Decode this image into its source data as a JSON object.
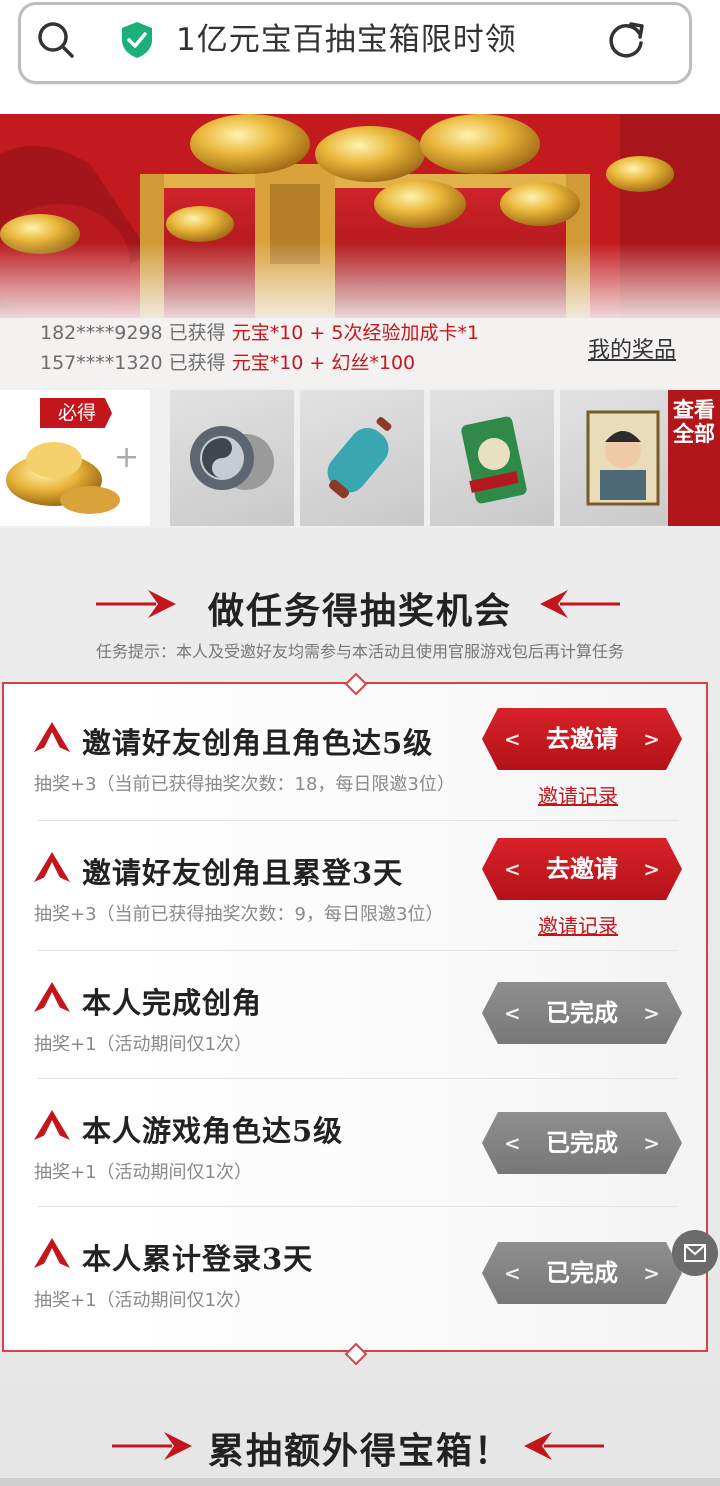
{
  "search": {
    "title": "1亿元宝百抽宝箱限时领"
  },
  "ticker": {
    "line1": {
      "phone": "182****9298 已获得 ",
      "prize": "元宝*10 + 5次经验加成卡*1"
    },
    "line2": {
      "phone": "157****1320 已获得 ",
      "prize": "元宝*10 + 幻丝*100"
    }
  },
  "my_prizes": "我的奖品",
  "prize_strip": {
    "must_badge": "必得",
    "plus": "+",
    "view_all": "查看全部"
  },
  "section1": {
    "title": "做任务得抽奖机会",
    "hint": "任务提示：本人及受邀好友均需参与本活动且使用官服游戏包后再计算任务"
  },
  "tasks": [
    {
      "title": "邀请好友创角且角色达5级",
      "sub": "抽奖+3（当前已获得抽奖次数：18，每日限邀3位）",
      "button": "去邀请",
      "state": "active",
      "record": "邀请记录"
    },
    {
      "title": "邀请好友创角且累登3天",
      "sub": "抽奖+3（当前已获得抽奖次数：9，每日限邀3位）",
      "button": "去邀请",
      "state": "active",
      "record": "邀请记录"
    },
    {
      "title": "本人完成创角",
      "sub": "抽奖+1（活动期间仅1次）",
      "button": "已完成",
      "state": "done"
    },
    {
      "title": "本人游戏角色达5级",
      "sub": "抽奖+1（活动期间仅1次）",
      "button": "已完成",
      "state": "done"
    },
    {
      "title": "本人累计登录3天",
      "sub": "抽奖+1（活动期间仅1次）",
      "button": "已完成",
      "state": "done"
    }
  ],
  "section2": {
    "title": "累抽额外得宝箱！"
  },
  "colors": {
    "accent": "#c3161c",
    "done_gray": "#858585"
  }
}
